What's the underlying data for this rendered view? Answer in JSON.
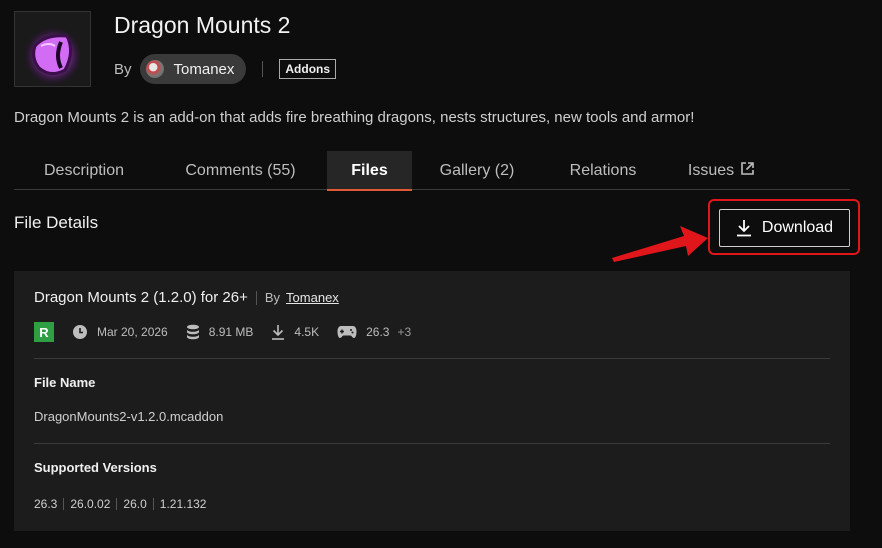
{
  "project": {
    "title": "Dragon Mounts 2",
    "by_label": "By",
    "author": "Tomanex",
    "category_tag": "Addons",
    "description": "Dragon Mounts 2 is an add-on that adds fire breathing dragons, nests structures, new tools and armor!"
  },
  "tabs": [
    {
      "label": "Description"
    },
    {
      "label": "Comments (55)"
    },
    {
      "label": "Files",
      "active": true
    },
    {
      "label": "Gallery (2)"
    },
    {
      "label": "Relations"
    },
    {
      "label": "Issues"
    }
  ],
  "file_details": {
    "heading": "File Details",
    "download_label": "Download"
  },
  "file": {
    "name_title": "Dragon Mounts 2 (1.2.0) for 26+",
    "by_label": "By",
    "author": "Tomanex",
    "release_badge": "R",
    "date": "Mar 20, 2026",
    "size": "8.91 MB",
    "downloads": "4.5K",
    "game_version": "26.3",
    "more_versions": "+3",
    "file_name_label": "File Name",
    "file_name": "DragonMounts2-v1.2.0.mcaddon",
    "supported_versions_label": "Supported Versions",
    "supported_versions": [
      "26.3",
      "26.0.02",
      "26.0",
      "1.21.132"
    ]
  },
  "colors": {
    "accent": "#e05a35",
    "highlight": "#e0161b",
    "release_green": "#2ea043",
    "logo_purple": "#b533e0"
  }
}
